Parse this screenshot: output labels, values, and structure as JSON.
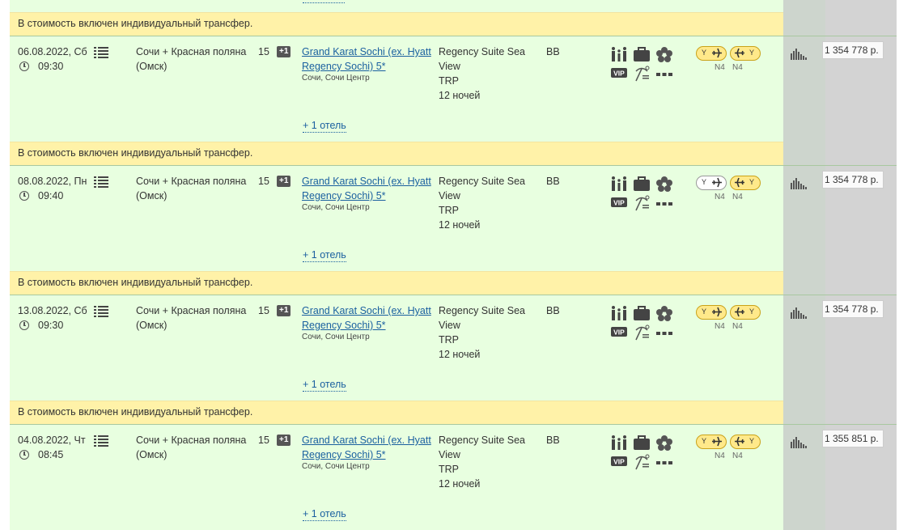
{
  "notice_text": "В стоимость включен индивидуальный трансфер.",
  "more_hotel_label": "+ 1 отель",
  "tour_line1": "Сочи + Красная поляна",
  "tour_line2": "(Омск)",
  "nights_count": "15",
  "badge": "+1",
  "hotel_name_line1": "Grand Karat Sochi (ex. Hyatt",
  "hotel_name_line2": "Regency Sochi) 5*",
  "hotel_location": "Сочи, Сочи Центр",
  "room_line1": "Regency Suite Sea",
  "room_line2": "View",
  "room_line3": "TRP",
  "room_line4": "12 ночей",
  "meal": "BB",
  "flight": {
    "class_out": "Y",
    "class_ret": "Y",
    "code_out": "N4",
    "code_ret": "N4"
  },
  "service_icons": [
    "family-icon",
    "luggage-icon",
    "flower-icon",
    "vip-icon",
    "beach-icon",
    "more-dots-icon"
  ],
  "colors": {
    "row_bg": "#e8ffe0",
    "notice_bg": "#fff2a8",
    "link": "#1a5f9f",
    "flight_pill": "#ffe98a"
  },
  "rows": [
    {
      "date": "06.08.2022, Сб",
      "time": "09:30",
      "price": "1 354 778 р.",
      "flight_out_available": true
    },
    {
      "date": "08.08.2022, Пн",
      "time": "09:40",
      "price": "1 354 778 р.",
      "flight_out_available": false
    },
    {
      "date": "13.08.2022, Сб",
      "time": "09:30",
      "price": "1 354 778 р.",
      "flight_out_available": true
    },
    {
      "date": "04.08.2022, Чт",
      "time": "08:45",
      "price": "1 355 851 р.",
      "flight_out_available": true
    }
  ]
}
